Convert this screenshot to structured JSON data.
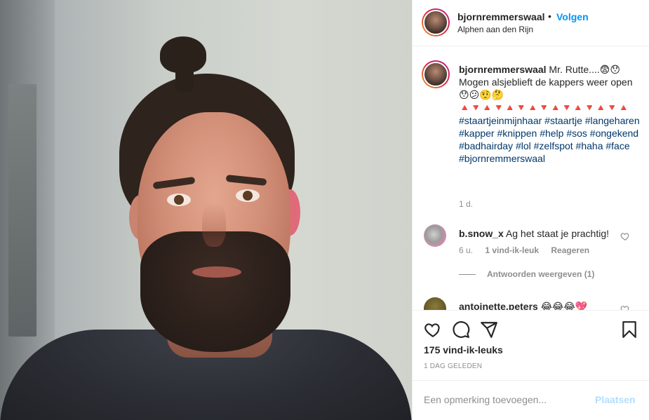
{
  "header": {
    "username": "bjornremmerswaal",
    "separator": "•",
    "follow_label": "Volgen",
    "location": "Alphen aan den Rijn"
  },
  "caption": {
    "username": "bjornremmerswaal",
    "text_line1": "Mr. Rutte....😨😯",
    "text_line2": "Mogen alsjeblieft de kappers weer open 😯😕🤨🤔",
    "triangles": "🔺🔻🔺🔻🔺🔻🔺🔻🔺🔻🔺🔻🔺🔻🔺",
    "hashtags": "#staartjeinmijnhaar #staartje #langeharen #kapper #knippen #help #sos #ongekend #badhairday #lol #zelfspot #haha #face #bjornremmerswaal",
    "time": "1 d."
  },
  "comments": [
    {
      "username": "b.snow_x",
      "text": "Ag het staat je prachtig!",
      "time": "6 u.",
      "likes": "1 vind-ik-leuk",
      "reply_label": "Reageren",
      "view_replies": "Antwoorden weergeven (1)"
    },
    {
      "username": "antoinette.peters",
      "text": "😂😂😂💖"
    }
  ],
  "actions": {
    "likes_count": "175 vind-ik-leuks",
    "date": "1 DAG GELEDEN"
  },
  "add_comment": {
    "placeholder": "Een opmerking toevoegen...",
    "post_label": "Plaatsen"
  },
  "colors": {
    "accent": "#0095f6",
    "post_disabled": "#b2dffc",
    "meta_gray": "#8e8e8e",
    "hashtag": "#00376b",
    "text": "#262626"
  }
}
